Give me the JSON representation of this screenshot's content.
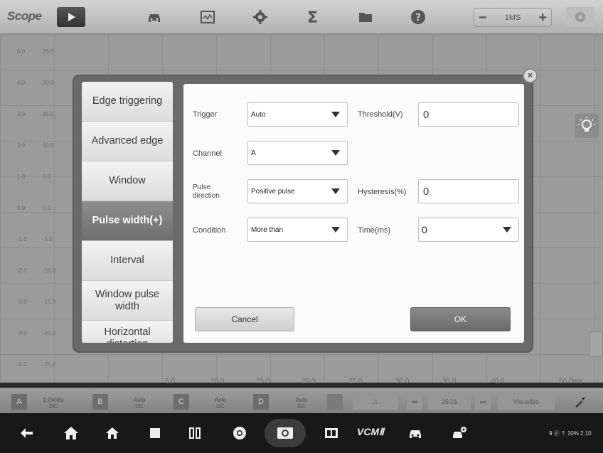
{
  "app": {
    "title": "Scope"
  },
  "timebase": {
    "minus": "−",
    "value": "1MS",
    "plus": "+"
  },
  "scope": {
    "left_scale_a": [
      "5.0",
      "4.0",
      "3.0",
      "2.0",
      "1.0",
      "0.0",
      "-1.0",
      "-2.0",
      "-3.0",
      "-4.0",
      "-5.0"
    ],
    "left_scale_b": [
      "25.0",
      "20.0",
      "15.0",
      "10.0",
      "5.0",
      "0.0",
      "-5.0",
      "-10.0",
      "-15.0",
      "-20.0",
      "-25.0"
    ],
    "x_ticks": [
      "5.0",
      "10.0",
      "15.0",
      "20.0",
      "25.0",
      "30.0",
      "35.0",
      "40.0",
      "50.0ms"
    ]
  },
  "dialog": {
    "close_label": "×",
    "menu": [
      {
        "label": "Edge triggering",
        "active": false
      },
      {
        "label": "Advanced edge",
        "active": false
      },
      {
        "label": "Window",
        "active": false
      },
      {
        "label": "Pulse width(+)",
        "active": true
      },
      {
        "label": "Interval",
        "active": false
      },
      {
        "label": "Window pulse width",
        "active": false
      },
      {
        "label": "Horizontal distortion",
        "active": false
      }
    ],
    "trigger": {
      "label": "Trigger",
      "value": "Auto"
    },
    "channel": {
      "label": "Channel",
      "value": "A"
    },
    "pulse_direction": {
      "label": "Pulse direction",
      "value": "Positive pulse"
    },
    "condition": {
      "label": "Condition",
      "value": "More than"
    },
    "threshold": {
      "label": "Threshold(V)",
      "value": "0"
    },
    "hysteresis": {
      "label": "Hysteresis(%)",
      "value": "0"
    },
    "time": {
      "label": "Time(ms)",
      "value": "0"
    },
    "cancel_label": "Cancel",
    "ok_label": "OK"
  },
  "channels": [
    {
      "name": "A",
      "scale": "1.0V/div",
      "coupling": "DC"
    },
    {
      "name": "B",
      "scale": "Auto",
      "coupling": "DC"
    },
    {
      "name": "C",
      "scale": "Auto",
      "coupling": "DC"
    },
    {
      "name": "D",
      "scale": "Auto",
      "coupling": "DC"
    }
  ],
  "channel_bar": {
    "frame": "25/21",
    "mode": "Visualize"
  },
  "navbar": {
    "vcm_label": "VCMⅡ",
    "status_text": "9 ⓟ ⇡ 10% 2:10"
  },
  "icons": [
    "back-icon",
    "home-icon",
    "house-icon",
    "recents-icon",
    "split-icon",
    "chrome-icon",
    "camera-icon",
    "screen-record-icon",
    "car-icon",
    "car-settings-icon"
  ],
  "colors": {
    "active_menu": "#7a7a7a",
    "ok_button": "#7a7a7a",
    "panel_bg": "#fbfbfb"
  }
}
